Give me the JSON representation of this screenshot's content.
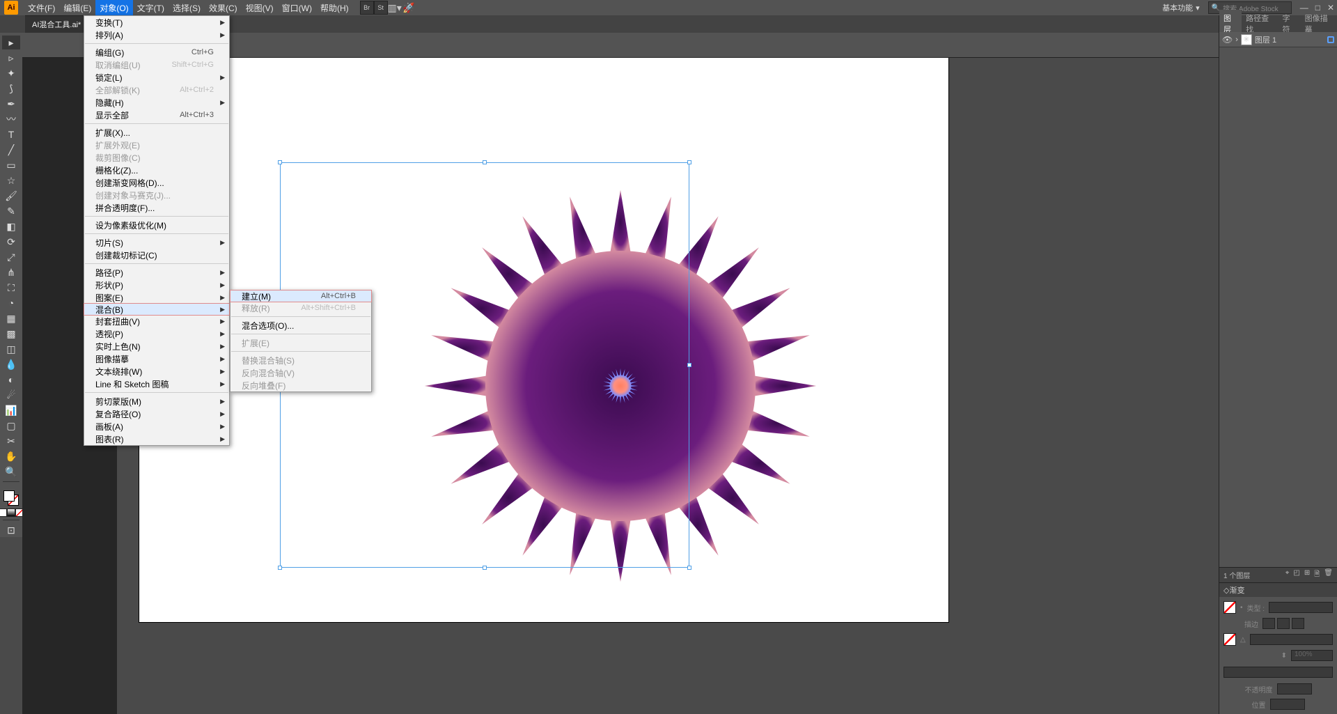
{
  "app": {
    "logo": "Ai"
  },
  "menubar": {
    "items": [
      "文件(F)",
      "编辑(E)",
      "对象(O)",
      "文字(T)",
      "选择(S)",
      "效果(C)",
      "视图(V)",
      "窗口(W)",
      "帮助(H)"
    ],
    "active_index": 2,
    "workspace": "基本功能",
    "search_placeholder": "搜索 Adobe Stock"
  },
  "document": {
    "tab": "AI混合工具.ai* @"
  },
  "object_menu": [
    {
      "label": "变换(T)",
      "sub": true
    },
    {
      "label": "排列(A)",
      "sub": true
    },
    {
      "sep": true
    },
    {
      "label": "编组(G)",
      "scut": "Ctrl+G"
    },
    {
      "label": "取消编组(U)",
      "scut": "Shift+Ctrl+G",
      "disabled": true
    },
    {
      "label": "锁定(L)",
      "sub": true
    },
    {
      "label": "全部解锁(K)",
      "scut": "Alt+Ctrl+2",
      "disabled": true
    },
    {
      "label": "隐藏(H)",
      "sub": true
    },
    {
      "label": "显示全部",
      "scut": "Alt+Ctrl+3"
    },
    {
      "sep": true
    },
    {
      "label": "扩展(X)..."
    },
    {
      "label": "扩展外观(E)",
      "disabled": true
    },
    {
      "label": "裁剪图像(C)",
      "disabled": true
    },
    {
      "label": "栅格化(Z)..."
    },
    {
      "label": "创建渐变网格(D)..."
    },
    {
      "label": "创建对象马赛克(J)...",
      "disabled": true
    },
    {
      "label": "拼合透明度(F)..."
    },
    {
      "sep": true
    },
    {
      "label": "设为像素级优化(M)"
    },
    {
      "sep": true
    },
    {
      "label": "切片(S)",
      "sub": true
    },
    {
      "label": "创建裁切标记(C)"
    },
    {
      "sep": true
    },
    {
      "label": "路径(P)",
      "sub": true
    },
    {
      "label": "形状(P)",
      "sub": true
    },
    {
      "label": "图案(E)",
      "sub": true
    },
    {
      "label": "混合(B)",
      "sub": true,
      "hover": true
    },
    {
      "label": "封套扭曲(V)",
      "sub": true
    },
    {
      "label": "透视(P)",
      "sub": true
    },
    {
      "label": "实时上色(N)",
      "sub": true
    },
    {
      "label": "图像描摹",
      "sub": true
    },
    {
      "label": "文本绕排(W)",
      "sub": true
    },
    {
      "label": "Line 和 Sketch 图稿",
      "sub": true
    },
    {
      "sep": true
    },
    {
      "label": "剪切蒙版(M)",
      "sub": true
    },
    {
      "label": "复合路径(O)",
      "sub": true
    },
    {
      "label": "画板(A)",
      "sub": true
    },
    {
      "label": "图表(R)",
      "sub": true
    }
  ],
  "blend_submenu": [
    {
      "label": "建立(M)",
      "scut": "Alt+Ctrl+B",
      "hover": true
    },
    {
      "label": "释放(R)",
      "scut": "Alt+Shift+Ctrl+B",
      "disabled": true
    },
    {
      "sep": true
    },
    {
      "label": "混合选项(O)..."
    },
    {
      "sep": true
    },
    {
      "label": "扩展(E)",
      "disabled": true
    },
    {
      "sep": true
    },
    {
      "label": "替换混合轴(S)",
      "disabled": true
    },
    {
      "label": "反向混合轴(V)",
      "disabled": true
    },
    {
      "label": "反向堆叠(F)",
      "disabled": true
    }
  ],
  "panels": {
    "layer_tabs": [
      "图层",
      "路径查找",
      "字符",
      "图像描摹"
    ],
    "layer_name": "图层 1",
    "layer_footer_count": "1 个图层",
    "gradient_title": "渐变",
    "grad_labels": {
      "type": "类型 :",
      "stroke": "描边",
      "angle": "△",
      "scale": "100%",
      "opacity": "不透明度",
      "position": "位置"
    }
  }
}
